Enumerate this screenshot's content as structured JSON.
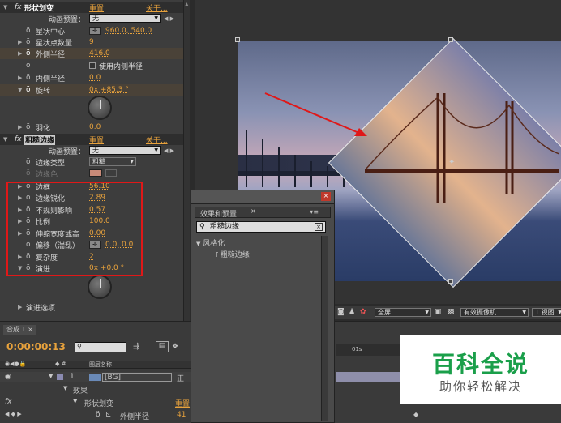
{
  "effect1": {
    "fx": "fx",
    "title": "形状划变",
    "reset": "重置",
    "about": "关于...",
    "preset_label": "动画预置：",
    "preset_value": "无",
    "props": [
      {
        "label": "星状中心",
        "value": "960.0, 540.0"
      },
      {
        "label": "星状点数量",
        "value": "9"
      },
      {
        "label": "外侧半径",
        "value": "416.0"
      },
      {
        "label": "使用内侧半径"
      },
      {
        "label": "内侧半径",
        "value": "0.0"
      },
      {
        "label": "旋转",
        "value": "0x +85.3 °"
      },
      {
        "label": "羽化",
        "value": "0.0"
      }
    ]
  },
  "effect2": {
    "fx": "fx",
    "title": "粗糙边缘",
    "reset": "重置",
    "about": "关于...",
    "preset_label": "动画预置：",
    "preset_value": "无",
    "props": [
      {
        "label": "边缘类型",
        "value": "粗糙"
      },
      {
        "label": "边缘色"
      },
      {
        "label": "边框",
        "value": "56.10"
      },
      {
        "label": "边缘锐化",
        "value": "2.89"
      },
      {
        "label": "不规则影响",
        "value": "0.57"
      },
      {
        "label": "比例",
        "value": "100.0"
      },
      {
        "label": "伸缩宽度或高",
        "value": "0.00"
      },
      {
        "label": "偏移（湍乱）",
        "value": "0.0, 0.0"
      },
      {
        "label": "复杂度",
        "value": "2"
      },
      {
        "label": "演进",
        "value": "0x +0.0 °"
      },
      {
        "label": "演进选项"
      }
    ]
  },
  "effects_panel": {
    "title": "效果和预置",
    "search": "粗糙边缘",
    "category": "风格化",
    "item": "粗糙边缘"
  },
  "comp_toolbar": {
    "zoom": "全屏",
    "camera": "有效摄像机",
    "views": "1 视图"
  },
  "timeline": {
    "tab": "合成 1",
    "timecode": "0:00:00:13",
    "col_name": "图层名称",
    "layer_num": "1",
    "layer_name": "[BG]",
    "mode": "正",
    "sub_effects": "效果",
    "sub_effect_name": "形状划变",
    "sub_reset": "重置",
    "sub_prop": "外侧半径",
    "sub_prop_value": "41",
    "ruler_label": "01s",
    "fx": "fx"
  },
  "watermark": {
    "title": "百科全说",
    "subtitle": "助你轻松解决"
  },
  "colors": {
    "accent": "#e8a23c",
    "annotation": "#e01818",
    "brand": "#1a9f4a"
  }
}
